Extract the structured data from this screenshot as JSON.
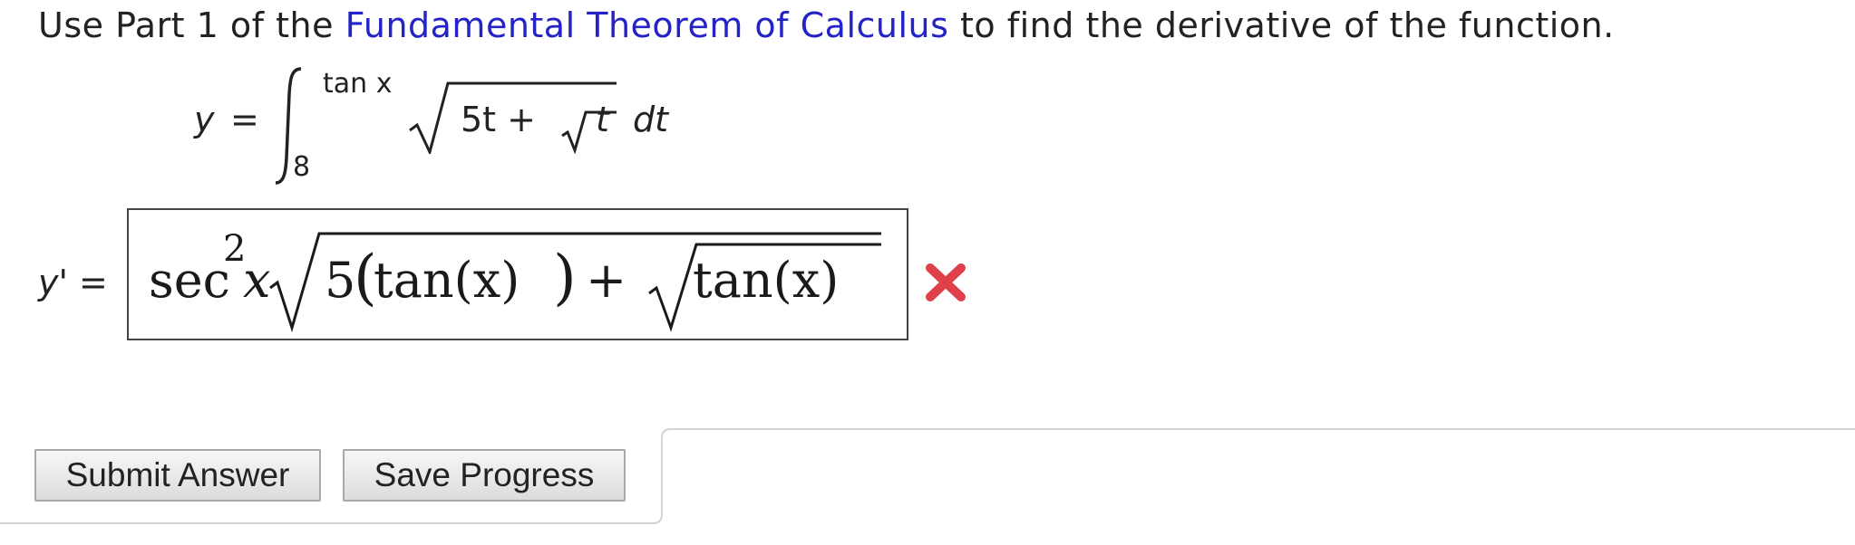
{
  "question": {
    "prefix": "Use Part 1 of the ",
    "link_text": "Fundamental Theorem of Calculus",
    "suffix": " to find the derivative of the function."
  },
  "formula": {
    "lhs": "y",
    "equals": "=",
    "integral_upper": "tan x",
    "integral_lower": "8",
    "integrand_head": "5t +",
    "integrand_inner": "t",
    "differential": "dt"
  },
  "answer": {
    "label_var": "y'",
    "label_eq": " =",
    "sec": "sec",
    "power": "2",
    "x": "x",
    "five": "5",
    "open_paren": "(",
    "tan_arg_1": "tan(x)",
    "close_paren": ")",
    "plus": "+",
    "tan_arg_2": "tan(x)",
    "status": "incorrect"
  },
  "buttons": {
    "submit": "Submit Answer",
    "save": "Save Progress"
  },
  "colors": {
    "link": "#2323c8",
    "wrong_mark": "#e0404a"
  }
}
